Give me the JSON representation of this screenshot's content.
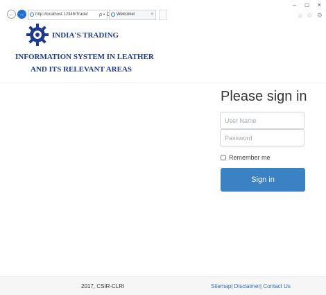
{
  "browser": {
    "address": "http://localhost:12345/Trade/",
    "address_actions": "ρ • C",
    "tab_title": "Welcome!",
    "tab_close": "×",
    "window_controls": "– □ ×",
    "toolbar_icons": "⌂ ☆ ⚙"
  },
  "header": {
    "logo_icon": "gear-emblem-icon",
    "title_line1": "INDIA'S TRADING",
    "title_line2": "INFORMATION SYSTEM IN LEATHER",
    "title_line3": "AND ITS RELEVANT AREAS",
    "title_color": "#1e3a8f"
  },
  "signin": {
    "heading": "Please sign in",
    "username_placeholder": "User Name",
    "username_value": "",
    "password_placeholder": "Password",
    "password_value": "",
    "remember_label": "Remember me",
    "remember_checked": false,
    "button_label": "Sign in",
    "button_color": "#3a82c4"
  },
  "footer": {
    "copyright": "2017, CSIR-CLRI",
    "link_sitemap": "Sitemap|",
    "link_disclaimer": "Disclaimer|",
    "link_contact": "Contact Us",
    "link_color": "#2d6fb3"
  }
}
